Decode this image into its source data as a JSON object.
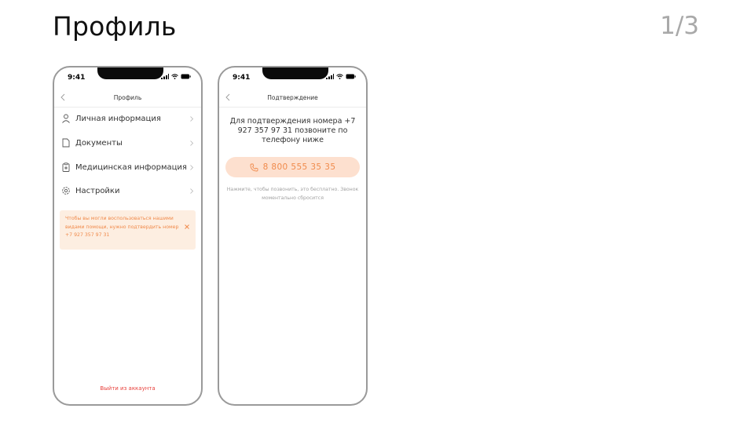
{
  "slide": {
    "title": "Профиль",
    "counter": "1/3"
  },
  "colors": {
    "accent": "#f08a4b",
    "accent_bg": "#fde0cf",
    "alert_bg": "#fdeee1",
    "danger": "#e8413c"
  },
  "phone1": {
    "status_time": "9:41",
    "nav_title": "Профиль",
    "menu": [
      {
        "label": "Личная информация",
        "icon": "person-icon"
      },
      {
        "label": "Документы",
        "icon": "document-icon"
      },
      {
        "label": "Медицинская информация",
        "icon": "medical-clipboard-icon"
      },
      {
        "label": "Настройки",
        "icon": "gear-icon"
      }
    ],
    "alert_text": "Чтобы вы могли воспользоваться нашими видами помощи, нужно подтвердить номер +7 927 357 97 31",
    "logout_label": "Выйти из аккаунта"
  },
  "phone2": {
    "status_time": "9:41",
    "nav_title": "Подтверждение",
    "confirm_text": "Для подтверждения номера +7 927 357 97 31 позвоните по телефону ниже",
    "call_number": "8 800 555 35 35",
    "hint_text": "Нажмите, чтобы позвонить, это бесплатно. Звонок моментально сбросится"
  }
}
